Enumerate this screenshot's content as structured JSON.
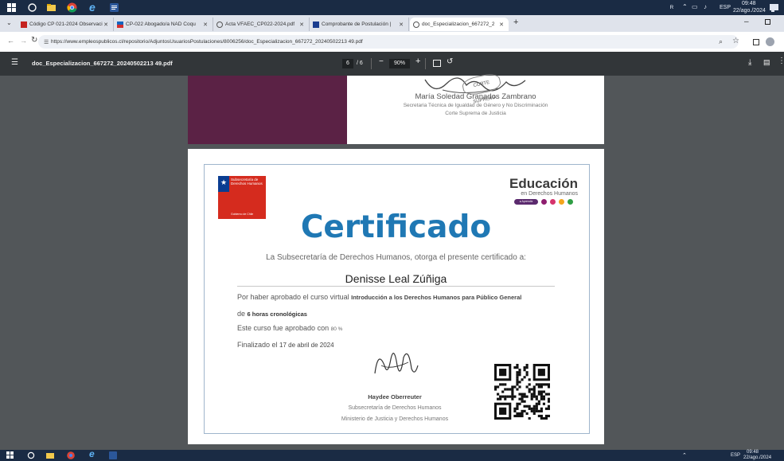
{
  "taskbar": {
    "tray": {
      "lang": "ESP",
      "time": "09:48",
      "date": "22/ago./2024"
    }
  },
  "tabs": [
    {
      "label": "Código CP 021-2024 Observaci",
      "fav_color": "#c5221f"
    },
    {
      "label": "CP-022 Abogado/a NAD Coqu",
      "fav_color": "#1565c0"
    },
    {
      "label": "Acta VFAEC_CP022-2024.pdf",
      "fav_color": "#555555"
    },
    {
      "label": "Comprobante de Postulación |",
      "fav_color": "#1a3d8f"
    },
    {
      "label": "doc_Especializacion_667272_2",
      "fav_color": "#555555"
    }
  ],
  "address": {
    "url": "https://www.empleospublicos.cl/repositorio/AdjuntosUsuariosPostulaciones/8006256/doc_Especializacion_667272_20240502213 49.pdf"
  },
  "pdf": {
    "filename": "doc_Especializacion_667272_20240502213 49.pdf",
    "page_current": "6",
    "page_total": "/ 6",
    "zoom": "90%"
  },
  "prev_page": {
    "signer_name": "María Soledad Granados Zambrano",
    "signer_role": "Secretaria Técnica de Igualdad de Género y No Discriminación",
    "signer_org": "Corte Suprema de Justicia",
    "stamp_text": "CORTE SUPREMA"
  },
  "cert": {
    "gov_unit": "Subsecretaría de Derechos Humanos",
    "gov_ministry": "Gobierno de Chile",
    "brand_title": "Educación",
    "brand_subtitle": "en Derechos Humanos",
    "brand_badge": "● Aprendiz",
    "dot_colors": [
      "#8e1e6f",
      "#d6336c",
      "#f4a51c",
      "#2f9e44"
    ],
    "title": "Certificado",
    "intro": "La Subsecretaría de Derechos Humanos, otorga el presente certificado a:",
    "recipient": "Denisse Leal Zúñiga",
    "line1_prefix": "Por haber aprobado el curso virtual",
    "course": "Introducción a los Derechos Humanos para Público General",
    "line2_prefix": "de",
    "hours": "6 horas cronológicas",
    "line3_prefix": "Este curso fue aprobado con",
    "score": "80 %",
    "line4_prefix": "Finalizado el",
    "finish_date": "17 de abril de 2024",
    "sig_name": "Haydee Oberreuter",
    "sig_role1": "Subsecretaría de Derechos Humanos",
    "sig_role2": "Ministerio de Justicia y Derechos Humanos"
  }
}
